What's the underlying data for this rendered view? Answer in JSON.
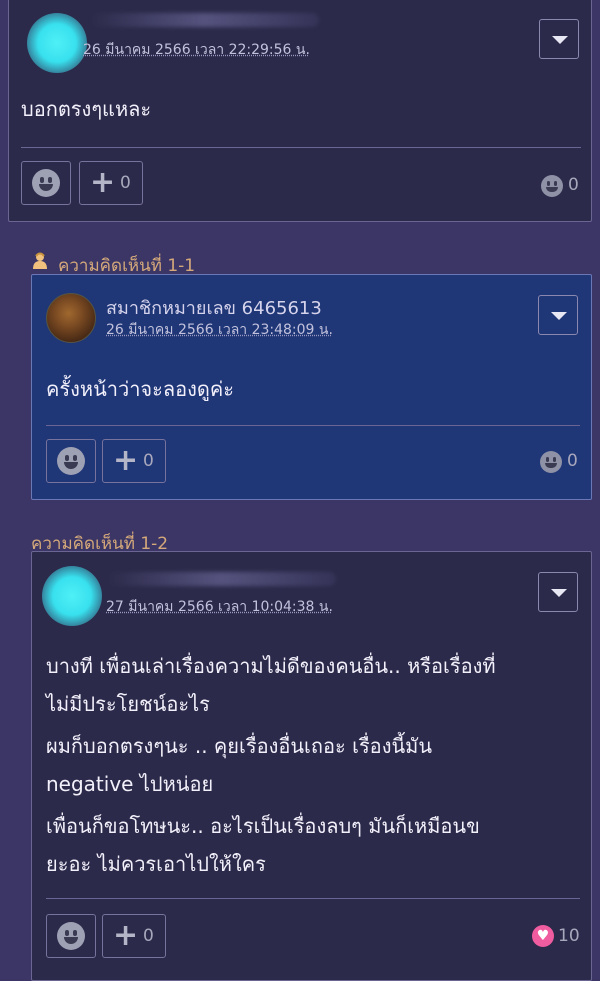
{
  "comment_top": {
    "date": "26 มีนาคม 2566 เวลา 22:29:56 น.",
    "text": "บอกตรงๆแหละ",
    "add_count": "0",
    "reaction_count": "0"
  },
  "reply_1": {
    "label": "ความคิดเห็นที่ 1-1",
    "author": "สมาชิกหมายเลข 6465613",
    "date": "26 มีนาคม 2566 เวลา 23:48:09 น.",
    "text": "ครั้งหน้าว่าจะลองดูค่ะ",
    "add_count": "0",
    "reaction_count": "0"
  },
  "reply_2": {
    "label": "ความคิดเห็นที่ 1-2",
    "date": "27 มีนาคม 2566 เวลา 10:04:38 น.",
    "lines": [
      "บางที เพื่อนเล่าเรื่องความไม่ดีของคนอื่น.. หรือเรื่องที่",
      "ไม่มีประโยชน์อะไร",
      "ผมก็บอกตรงๆนะ .. คุยเรื่องอื่นเถอะ เรื่องนี้มัน",
      "negative ไปหน่อย",
      "เพื่อนก็ขอโทษนะ..   อะไรเป็นเรื่องลบๆ มันก็เหมือนข",
      "ยะอะ ไม่ควรเอาไปให้ใคร"
    ],
    "add_count": "0",
    "reaction_count": "10"
  },
  "colors": {
    "background": "#3c3666",
    "card": "#2c2a4a",
    "card_highlight": "#1f3677",
    "label": "#d5a97a",
    "heart": "#f05ca0"
  },
  "icons": {
    "emotion": "smiley-icon",
    "add": "plus-icon",
    "menu": "chevron-down-icon",
    "owner": "person-icon",
    "love": "heart-icon"
  }
}
